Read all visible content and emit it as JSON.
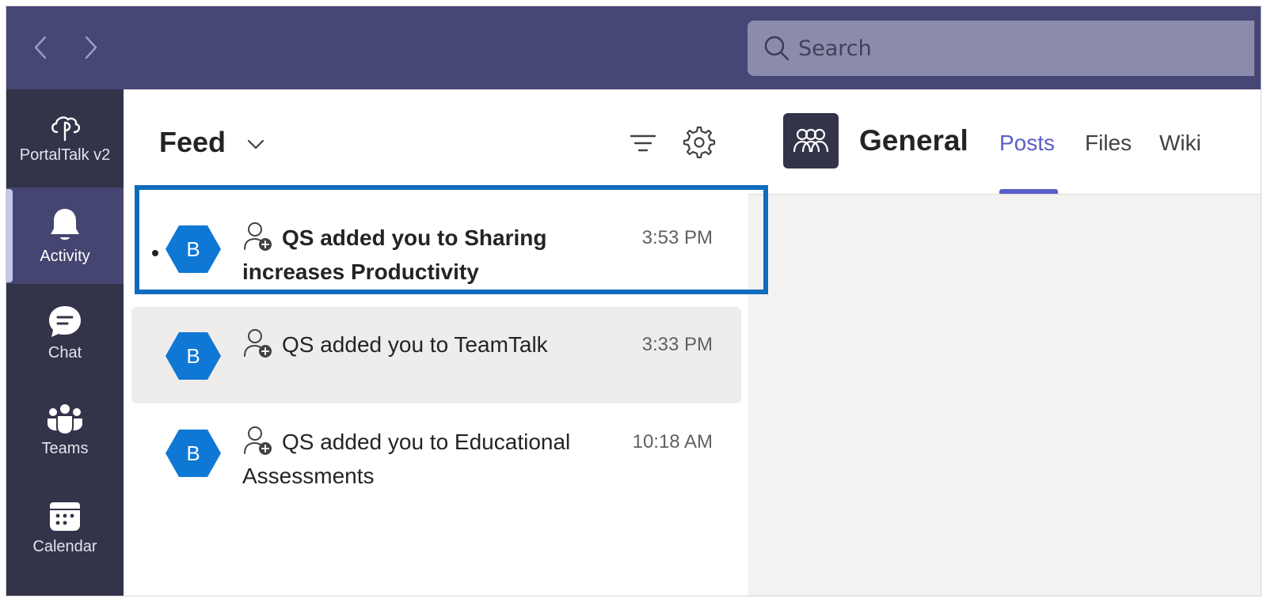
{
  "search": {
    "placeholder": "Search"
  },
  "rail": {
    "items": [
      {
        "label": "PortalTalk v2",
        "icon": "cloud-app-icon"
      },
      {
        "label": "Activity",
        "icon": "bell-icon",
        "active": true
      },
      {
        "label": "Chat",
        "icon": "chat-icon"
      },
      {
        "label": "Teams",
        "icon": "teams-icon"
      },
      {
        "label": "Calendar",
        "icon": "calendar-icon"
      }
    ]
  },
  "feed": {
    "title": "Feed",
    "items": [
      {
        "avatar": "B",
        "line1": "QS added you to Sharing",
        "line2": "increases Productivity",
        "time": "3:53 PM",
        "unread": true
      },
      {
        "avatar": "B",
        "line1": "QS added you to TeamTalk",
        "line2": "",
        "time": "3:33 PM",
        "unread": false
      },
      {
        "avatar": "B",
        "line1": "QS added you to Educational",
        "line2": "Assessments",
        "time": "10:18 AM",
        "unread": false
      }
    ]
  },
  "channel": {
    "name": "General",
    "tabs": [
      {
        "label": "Posts",
        "active": true
      },
      {
        "label": "Files"
      },
      {
        "label": "Wiki"
      }
    ]
  },
  "colors": {
    "topbar": "#464775",
    "rail": "#33344a",
    "accent": "#5b5fc7",
    "avatar": "#0f78d4",
    "highlight": "#0f6cbd"
  }
}
